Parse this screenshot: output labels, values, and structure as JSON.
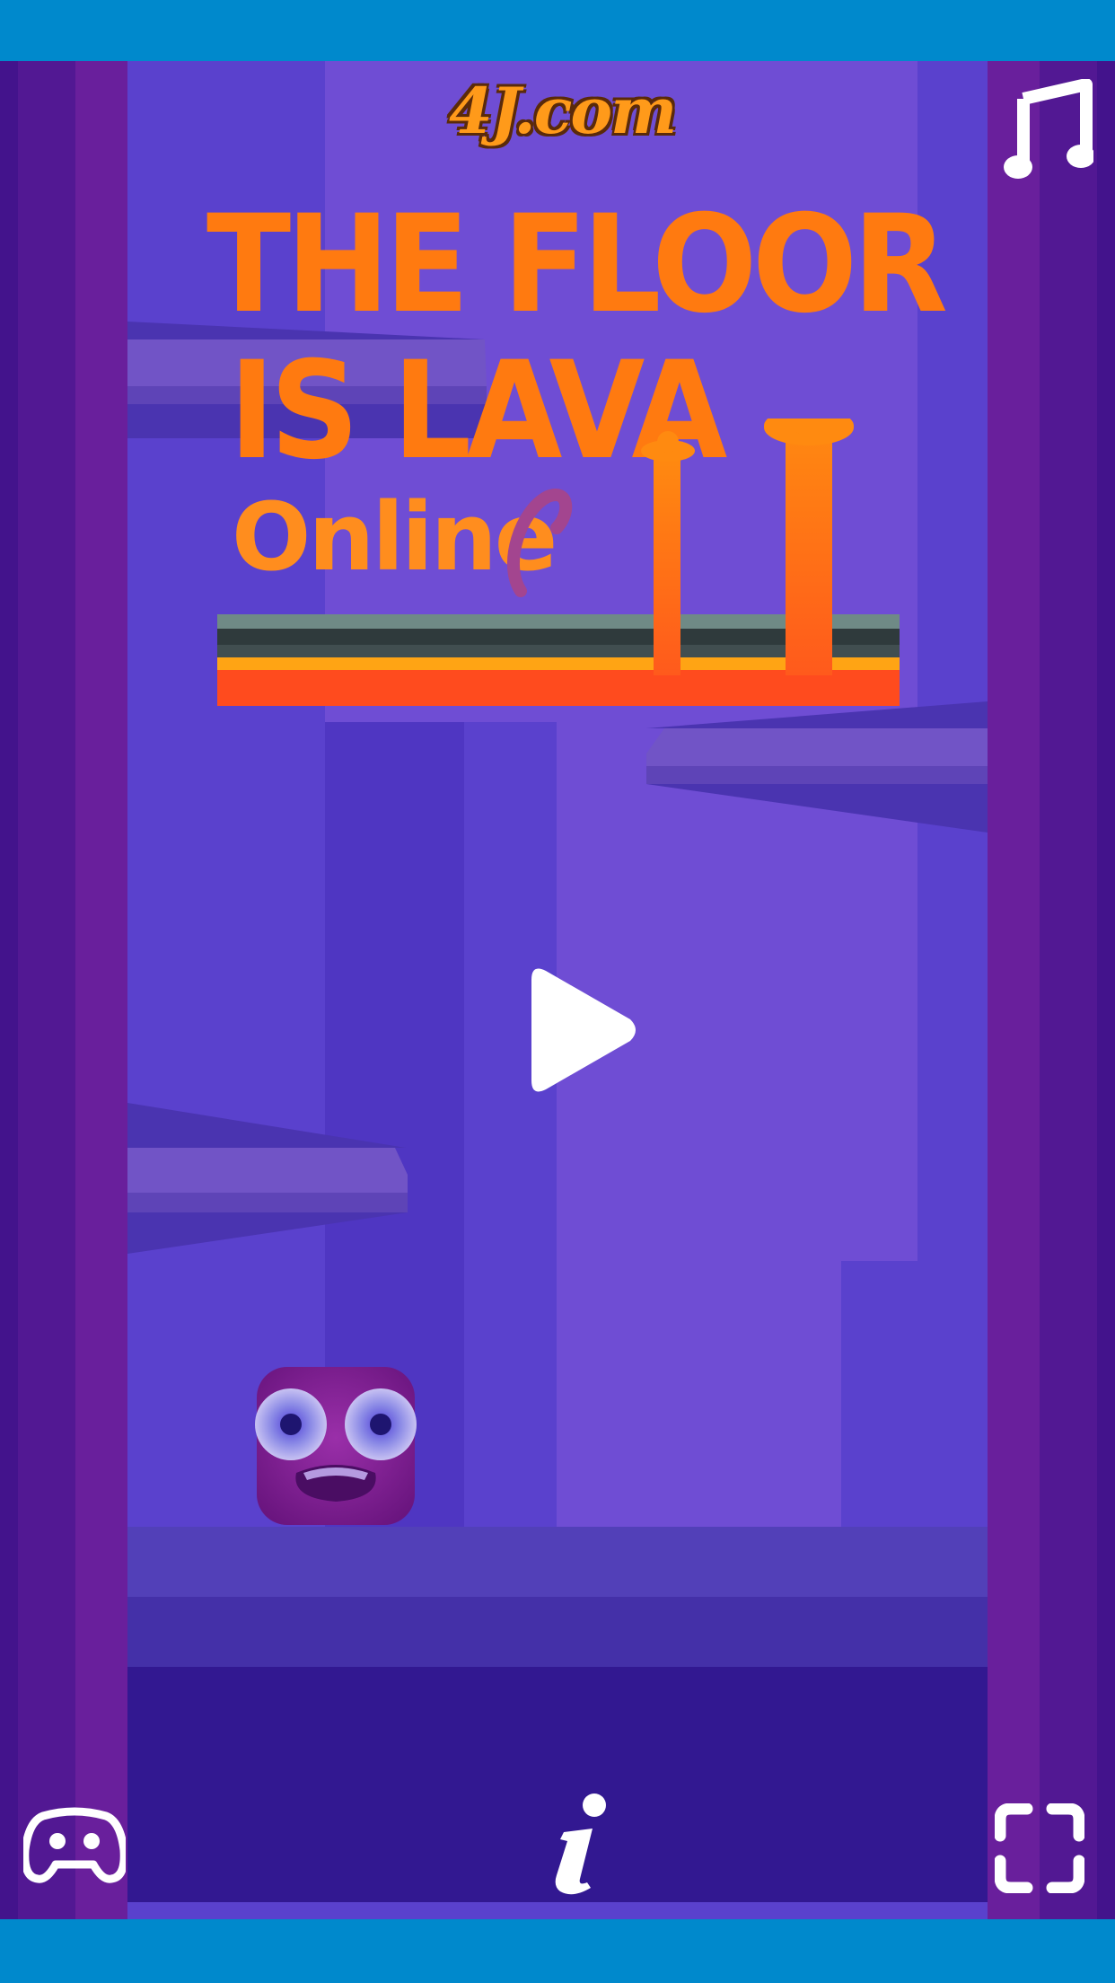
{
  "logo": {
    "text": "4J.com"
  },
  "title": {
    "line1": "THE FLOOR",
    "line2": "IS LAVA",
    "line3": "Online"
  },
  "buttons": {
    "play": "play-icon",
    "music": "music-icon",
    "gamepad": "gamepad-icon",
    "info": "info-icon",
    "fullscreen": "fullscreen-icon"
  },
  "colors": {
    "frame": "#0089cc",
    "background": "#5a41cd",
    "walls": "#691f9c",
    "lava": "#ff4b1e",
    "title_orange": "#ff7a10"
  }
}
